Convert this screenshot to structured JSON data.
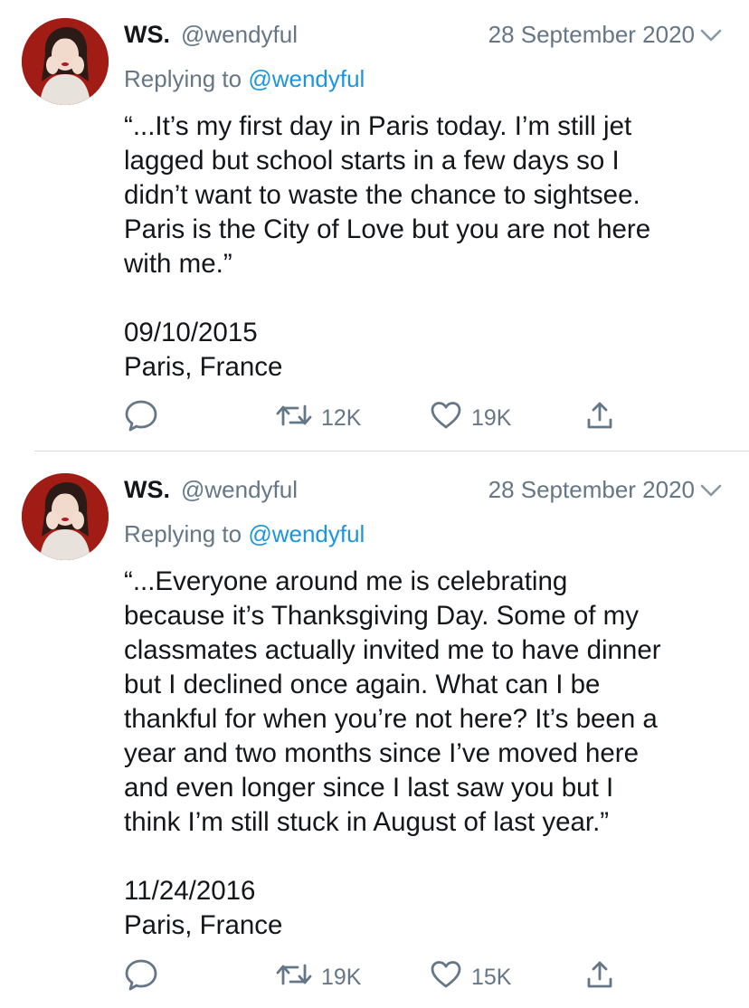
{
  "tweets": [
    {
      "display_name": "WS.",
      "handle": "@wendyful",
      "date": "28 September 2020",
      "reply_prefix": "Replying to",
      "reply_to": "@wendyful",
      "text": "“...It’s my first day in Paris today. I’m still jet\nlagged but school starts in a few days so I\ndidn’t want to waste the chance to sightsee.\nParis is the City of Love but you are not here\nwith me.”\n\n09/10/2015\nParis, France",
      "retweets": "12K",
      "likes": "19K"
    },
    {
      "display_name": "WS.",
      "handle": "@wendyful",
      "date": "28 September 2020",
      "reply_prefix": "Replying to",
      "reply_to": "@wendyful",
      "text": "“...Everyone around me is celebrating\nbecause it’s Thanksgiving Day. Some of my\nclassmates actually invited me to have dinner\nbut I declined once again. What can I be\nthankful for when you’re not here? It’s been a\nyear and two months since I’ve moved here\nand even longer since I last saw you but I\nthink I’m still stuck in August of last year.”\n\n11/24/2016\nParis, France",
      "retweets": "19K",
      "likes": "15K"
    }
  ],
  "icons": {
    "reply": "speech-bubble-icon",
    "retweet": "retweet-arrows-icon",
    "like": "heart-outline-icon",
    "share": "share-upload-icon",
    "menu": "chevron-down-icon"
  },
  "colors": {
    "text": "#14171a",
    "secondary": "#657786",
    "link": "#1b95e0",
    "divider": "#d6dbdf",
    "avatar_bg": "#a11c14"
  }
}
